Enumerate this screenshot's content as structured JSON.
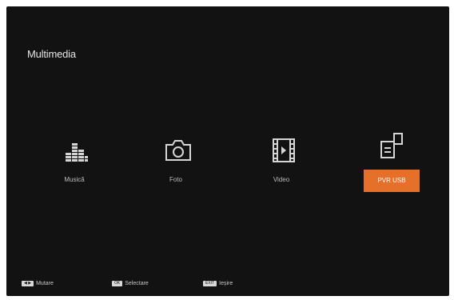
{
  "screen": {
    "title": "Multimedia"
  },
  "menu": {
    "items": [
      {
        "label": "Musică",
        "sub": "",
        "icon": "music-equalizer-icon"
      },
      {
        "label": "Foto",
        "sub": "",
        "icon": "camera-icon"
      },
      {
        "label": "Video",
        "sub": "",
        "icon": "video-film-icon"
      },
      {
        "label": "PVR USB",
        "sub": "",
        "icon": "usb-storage-icon",
        "selected": true
      }
    ]
  },
  "footer": {
    "hints": [
      {
        "key": "◀ ▶",
        "text": "Mutare"
      },
      {
        "key": "OK",
        "text": "Selectare"
      },
      {
        "key": "EXIT",
        "text": "Ieșire"
      }
    ]
  },
  "colors": {
    "background": "#121212",
    "accent": "#e5702a",
    "text": "#e6e6e6"
  }
}
